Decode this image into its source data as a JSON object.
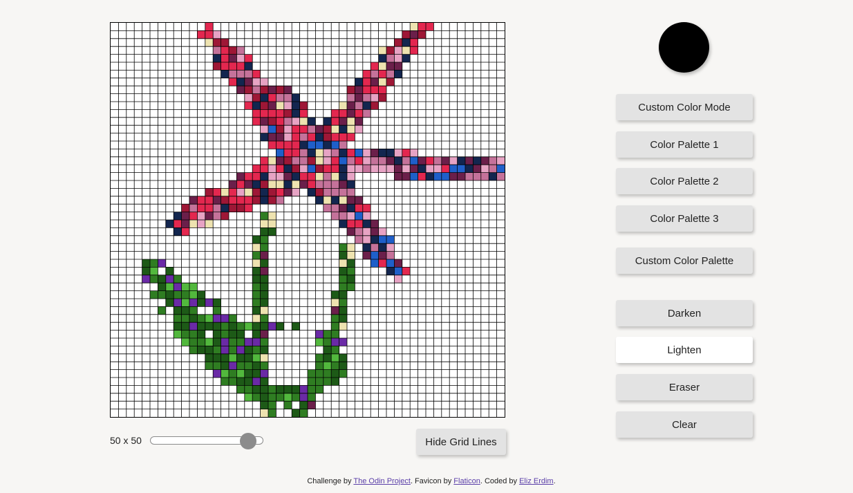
{
  "current_color": "#000000",
  "grid": {
    "size_label": "50 x 50",
    "cells": 50,
    "slider_value": 50,
    "slider_max": 64,
    "hide_grid_label": "Hide Grid Lines"
  },
  "sidebar": {
    "buttons": [
      {
        "label": "Custom Color Mode"
      },
      {
        "label": "Color Palette 1"
      },
      {
        "label": "Color Palette 2"
      },
      {
        "label": "Color Palette 3"
      },
      {
        "label": "Custom Color Palette"
      },
      {
        "label": "Darken"
      },
      {
        "label": "Lighten",
        "active": true
      },
      {
        "label": "Eraser"
      },
      {
        "label": "Clear"
      }
    ]
  },
  "footer": {
    "prefix": "Challenge by ",
    "link1": "The Odin Project",
    "mid1": ". Favicon by ",
    "link2": "Flaticon",
    "mid2": ". Coded by ",
    "link3": "Eliz Erdim",
    "suffix": "."
  },
  "palette": {
    "crimson": "#e3274f",
    "dark_red": "#9e1736",
    "plum": "#6b1f4a",
    "pink": "#c5729a",
    "light_pink": "#e7a3c4",
    "navy": "#13264f",
    "blue": "#1f5fc9",
    "cream": "#eee3b0",
    "black": "#0b0b12",
    "purple": "#6a2aa6",
    "dark_green": "#1d5a17",
    "green": "#2f7d22",
    "light_green": "#52b83d",
    "grid_line": "#000000"
  }
}
